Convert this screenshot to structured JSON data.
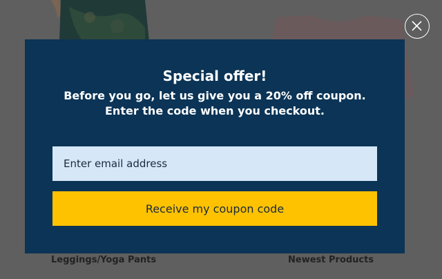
{
  "background": {
    "products": [
      {
        "label": "Leggings/Yoga Pants"
      },
      {
        "label": "Newest Products"
      }
    ]
  },
  "close": {
    "icon": "close-icon"
  },
  "modal": {
    "title": "Special offer!",
    "message_line1": "Before you go, let us give you a 20% off coupon.",
    "message_line2": "Enter the code when you checkout.",
    "email_placeholder": "Enter email address",
    "email_value": "",
    "submit_label": "Receive my coupon code",
    "colors": {
      "modal_bg": "#0b3456",
      "input_bg": "#d6e7f7",
      "button_bg": "#ffc200"
    }
  }
}
